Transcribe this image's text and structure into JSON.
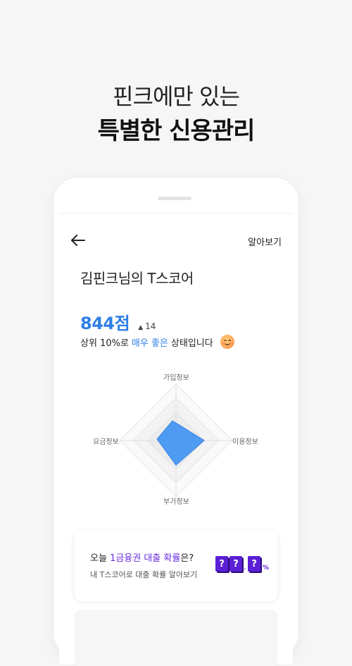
{
  "hero": {
    "line1": "핀크에만 있는",
    "line2": "특별한 신용관리"
  },
  "header": {
    "back_icon": "arrow-left-icon",
    "learn_more": "알아보기"
  },
  "score": {
    "title": "김핀크님의 T스코어",
    "value": "844점",
    "delta_icon": "▲",
    "delta": "14",
    "status_prefix": "상위 10%로",
    "status_highlight": "매우 좋은",
    "status_suffix": "상태입니다",
    "status_emoji": "smile-face-icon"
  },
  "radar": {
    "labels": {
      "top": "가입정보",
      "right": "이용정보",
      "bottom": "부가정보",
      "left": "요금정보"
    },
    "fill_color": "#4f9bf3"
  },
  "loan_card": {
    "title_prefix": "오늘",
    "title_highlight": "1금융권 대출 확률",
    "title_suffix": "은?",
    "subtitle": "내 T스코어로 대출 확률 알아보기",
    "box1": "?",
    "box2": "?",
    "box3": "?",
    "dot": ".",
    "percent": "%"
  },
  "colors": {
    "accent": "#2f7fe6",
    "purple": "#5b1fd6"
  }
}
